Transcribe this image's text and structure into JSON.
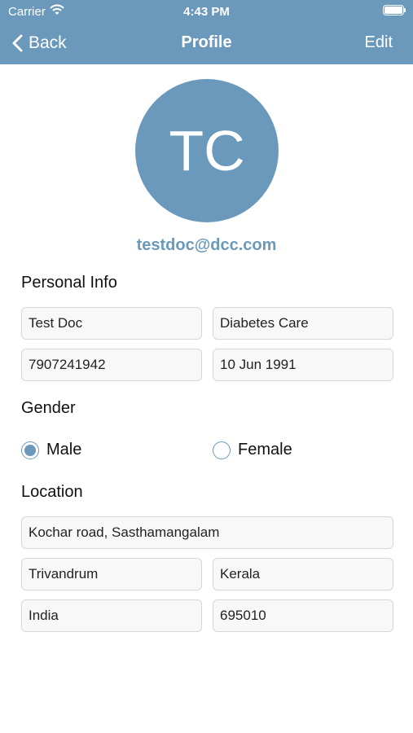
{
  "status_bar": {
    "carrier": "Carrier",
    "time": "4:43 PM"
  },
  "nav": {
    "back_label": "Back",
    "title": "Profile",
    "edit_label": "Edit"
  },
  "profile": {
    "initials": "TC",
    "email": "testdoc@dcc.com"
  },
  "sections": {
    "personal_info": "Personal Info",
    "gender": "Gender",
    "location": "Location"
  },
  "personal": {
    "name": "Test Doc",
    "organization": "Diabetes Care",
    "phone": "7907241942",
    "dob": "10 Jun 1991"
  },
  "gender": {
    "options": [
      "Male",
      "Female"
    ],
    "selected": "Male"
  },
  "location": {
    "address": "Kochar road, Sasthamangalam",
    "city": "Trivandrum",
    "state": "Kerala",
    "country": "India",
    "pincode": "695010"
  },
  "colors": {
    "accent": "#6b99bb",
    "field_bg": "#f8f8f8",
    "field_border": "#d7d7d7"
  }
}
